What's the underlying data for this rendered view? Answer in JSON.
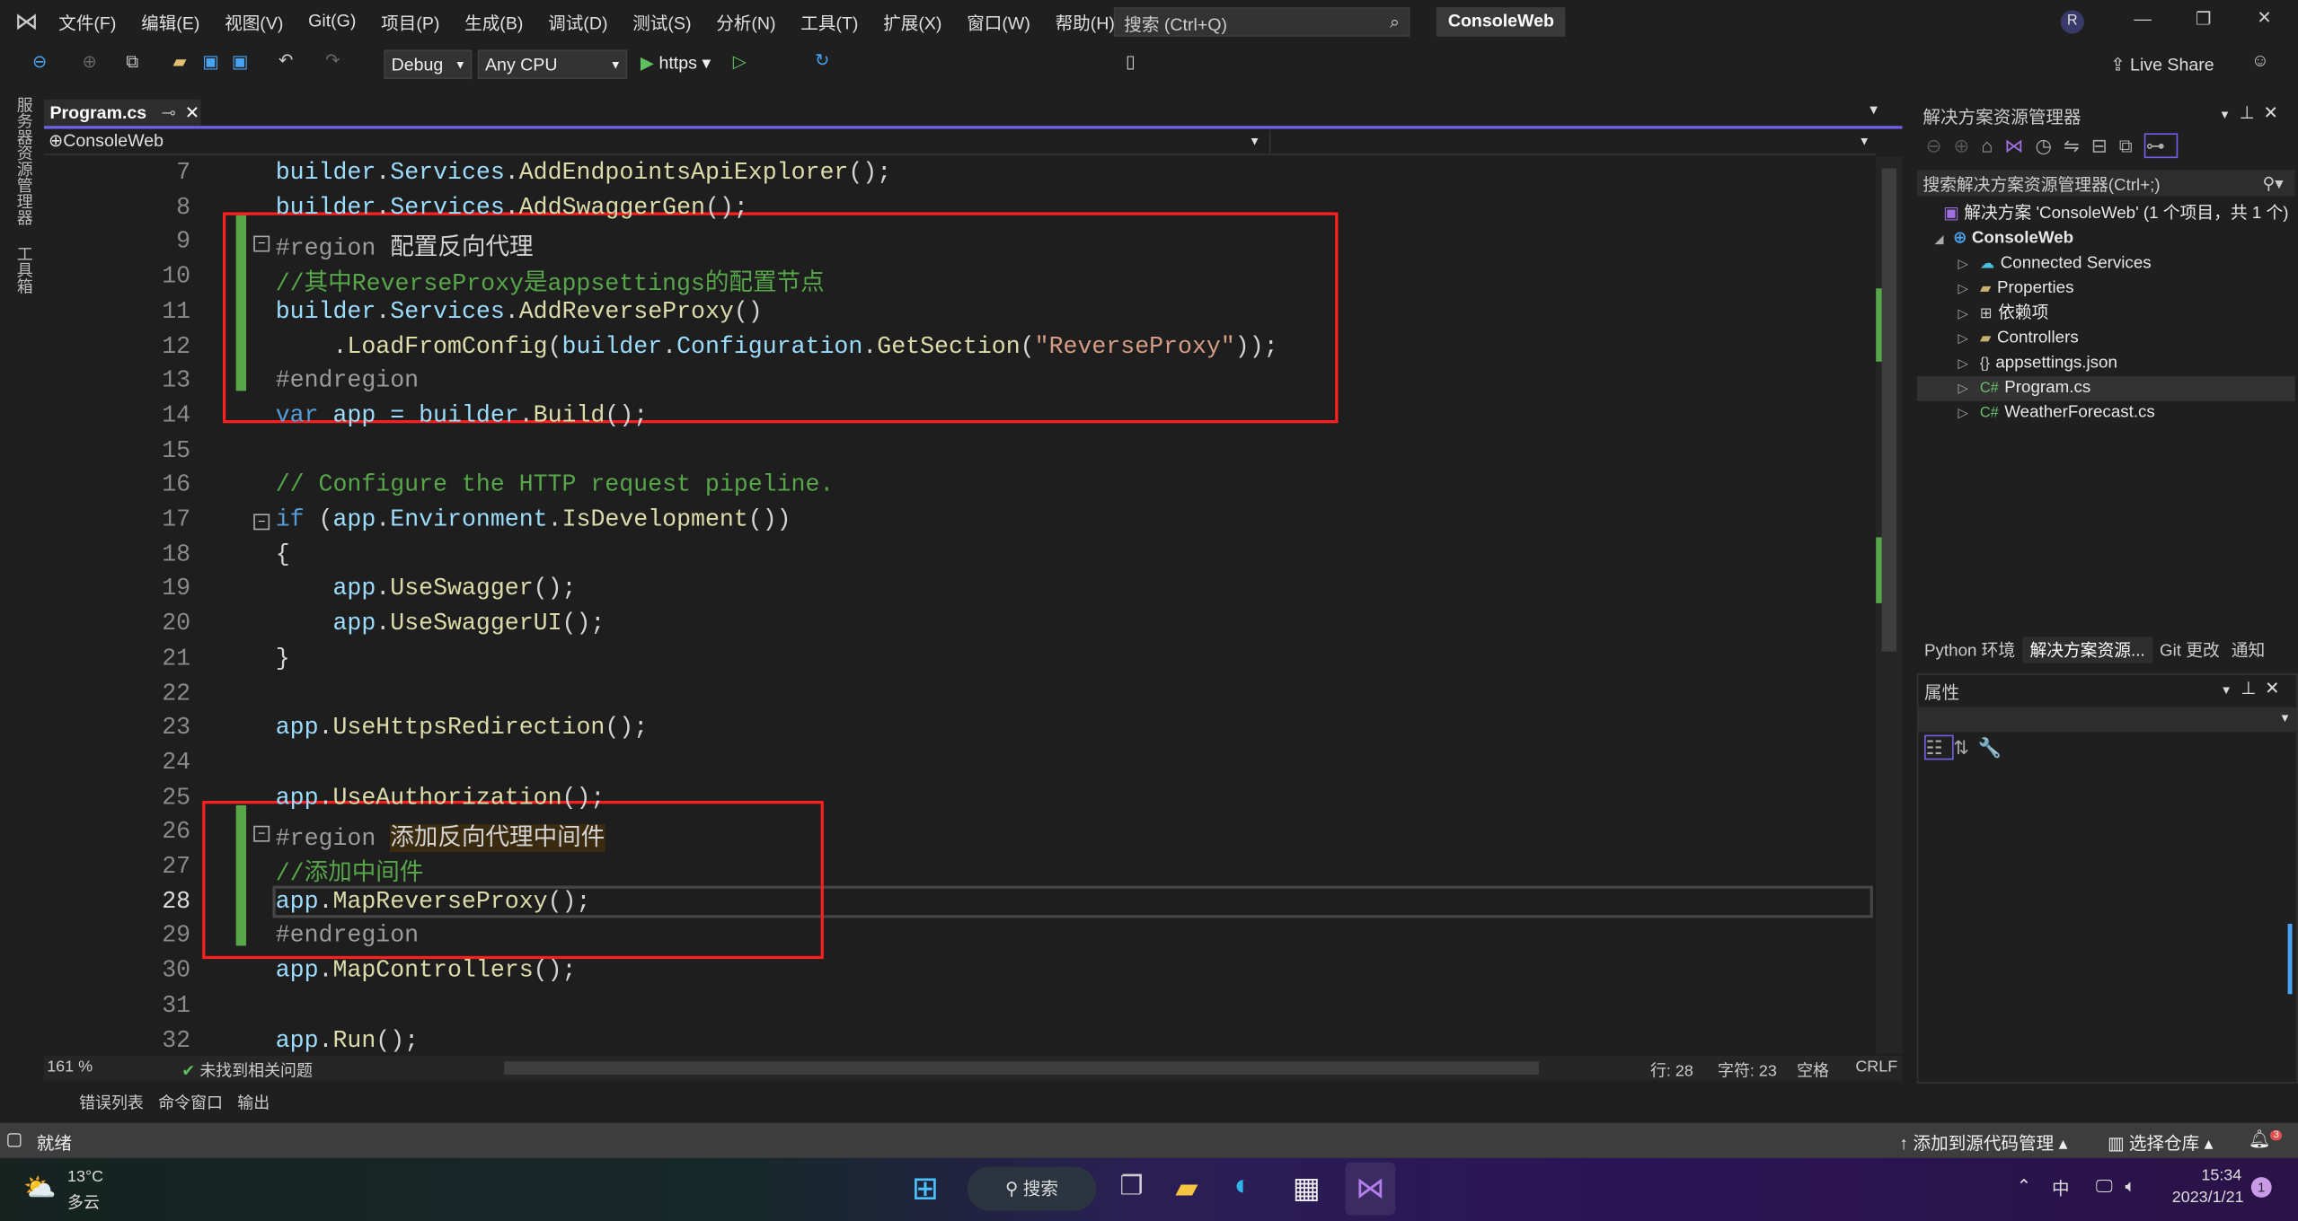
{
  "menu": {
    "items": [
      "文件(F)",
      "编辑(E)",
      "视图(V)",
      "Git(G)",
      "项目(P)",
      "生成(B)",
      "调试(D)",
      "测试(S)",
      "分析(N)",
      "工具(T)",
      "扩展(X)",
      "窗口(W)",
      "帮助(H)"
    ],
    "search_placeholder": "搜索 (Ctrl+Q)",
    "solution_title": "ConsoleWeb",
    "avatar": "R"
  },
  "toolbar": {
    "config": "Debug",
    "platform": "Any CPU",
    "run_target": "https",
    "live_share": "Live Share"
  },
  "left_strip": [
    "服务器资源管理器",
    "工具箱"
  ],
  "editor": {
    "tab": "Program.cs",
    "nav_project": "ConsoleWeb",
    "lines": [
      {
        "n": "7",
        "tokens": [
          [
            "builder",
            "id"
          ],
          [
            ".",
            "p"
          ],
          [
            "Services",
            "id"
          ],
          [
            ".",
            "p"
          ],
          [
            "AddEndpointsApiExplorer",
            "m"
          ],
          [
            "();",
            "p"
          ]
        ]
      },
      {
        "n": "8",
        "tokens": [
          [
            "builder",
            "id"
          ],
          [
            ".",
            "p"
          ],
          [
            "Services",
            "id"
          ],
          [
            ".",
            "p"
          ],
          [
            "AddSwaggerGen",
            "m"
          ],
          [
            "();",
            "p"
          ]
        ]
      },
      {
        "n": "9",
        "tokens": [
          [
            "#region ",
            "r"
          ],
          [
            "配置反向代理",
            "cn"
          ]
        ]
      },
      {
        "n": "10",
        "tokens": [
          [
            "//其中ReverseProxy是appsettings的配置节点",
            "c"
          ]
        ]
      },
      {
        "n": "11",
        "tokens": [
          [
            "builder",
            "id"
          ],
          [
            ".",
            "p"
          ],
          [
            "Services",
            "id"
          ],
          [
            ".",
            "p"
          ],
          [
            "AddReverseProxy",
            "m"
          ],
          [
            "()",
            "p"
          ]
        ]
      },
      {
        "n": "12",
        "tokens": [
          [
            "    .",
            "p"
          ],
          [
            "LoadFromConfig",
            "m"
          ],
          [
            "(",
            "p"
          ],
          [
            "builder",
            "id"
          ],
          [
            ".",
            "p"
          ],
          [
            "Configuration",
            "id"
          ],
          [
            ".",
            "p"
          ],
          [
            "GetSection",
            "m"
          ],
          [
            "(",
            "p"
          ],
          [
            "\"ReverseProxy\"",
            "s"
          ],
          [
            "));",
            "p"
          ]
        ]
      },
      {
        "n": "13",
        "tokens": [
          [
            "#endregion",
            "r"
          ]
        ]
      },
      {
        "n": "14",
        "tokens": [
          [
            "var",
            "k"
          ],
          [
            " app = ",
            "id"
          ],
          [
            "builder",
            "id"
          ],
          [
            ".",
            "p"
          ],
          [
            "Build",
            "m"
          ],
          [
            "();",
            "p"
          ]
        ]
      },
      {
        "n": "15",
        "tokens": []
      },
      {
        "n": "16",
        "tokens": [
          [
            "// Configure the HTTP request pipeline.",
            "c"
          ]
        ]
      },
      {
        "n": "17",
        "tokens": [
          [
            "if",
            "k"
          ],
          [
            " (",
            "p"
          ],
          [
            "app",
            "id"
          ],
          [
            ".",
            "p"
          ],
          [
            "Environment",
            "id"
          ],
          [
            ".",
            "p"
          ],
          [
            "IsDevelopment",
            "m"
          ],
          [
            "())",
            "p"
          ]
        ]
      },
      {
        "n": "18",
        "tokens": [
          [
            "{",
            "p"
          ]
        ]
      },
      {
        "n": "19",
        "tokens": [
          [
            "    app",
            "id"
          ],
          [
            ".",
            "p"
          ],
          [
            "UseSwagger",
            "m"
          ],
          [
            "();",
            "p"
          ]
        ]
      },
      {
        "n": "20",
        "tokens": [
          [
            "    app",
            "id"
          ],
          [
            ".",
            "p"
          ],
          [
            "UseSwaggerUI",
            "m"
          ],
          [
            "();",
            "p"
          ]
        ]
      },
      {
        "n": "21",
        "tokens": [
          [
            "}",
            "p"
          ]
        ]
      },
      {
        "n": "22",
        "tokens": []
      },
      {
        "n": "23",
        "tokens": [
          [
            "app",
            "id"
          ],
          [
            ".",
            "p"
          ],
          [
            "UseHttpsRedirection",
            "m"
          ],
          [
            "();",
            "p"
          ]
        ]
      },
      {
        "n": "24",
        "tokens": []
      },
      {
        "n": "25",
        "tokens": [
          [
            "app",
            "id"
          ],
          [
            ".",
            "p"
          ],
          [
            "UseAuthorization",
            "m"
          ],
          [
            "();",
            "p"
          ]
        ]
      },
      {
        "n": "26",
        "tokens": [
          [
            "#region ",
            "r"
          ],
          [
            "添加反向代理中间件",
            "cn"
          ]
        ]
      },
      {
        "n": "27",
        "tokens": [
          [
            "//添加中间件",
            "c"
          ]
        ]
      },
      {
        "n": "28",
        "tokens": [
          [
            "app",
            "id"
          ],
          [
            ".",
            "p"
          ],
          [
            "MapReverseProxy",
            "m"
          ],
          [
            "();",
            "p"
          ]
        ]
      },
      {
        "n": "29",
        "tokens": [
          [
            "#endregion",
            "r"
          ]
        ]
      },
      {
        "n": "30",
        "tokens": [
          [
            "app",
            "id"
          ],
          [
            ".",
            "p"
          ],
          [
            "MapControllers",
            "m"
          ],
          [
            "();",
            "p"
          ]
        ]
      },
      {
        "n": "31",
        "tokens": []
      },
      {
        "n": "32",
        "tokens": [
          [
            "app",
            "id"
          ],
          [
            ".",
            "p"
          ],
          [
            "Run",
            "m"
          ],
          [
            "();",
            "p"
          ]
        ]
      }
    ],
    "zoom": "161 %",
    "issues": "未找到相关问题",
    "line": "行: 28",
    "col": "字符: 23",
    "whitespace": "空格",
    "eol": "CRLF"
  },
  "solution_explorer": {
    "title": "解决方案资源管理器",
    "search_placeholder": "搜索解决方案资源管理器(Ctrl+;)",
    "solution": "解决方案 'ConsoleWeb' (1 个项目，共 1 个)",
    "project": "ConsoleWeb",
    "items": [
      {
        "label": "Connected Services",
        "icon": "cloud-plug"
      },
      {
        "label": "Properties",
        "icon": "folder-wrench"
      },
      {
        "label": "依赖项",
        "icon": "dependencies"
      },
      {
        "label": "Controllers",
        "icon": "folder"
      },
      {
        "label": "appsettings.json",
        "icon": "json-file"
      },
      {
        "label": "Program.cs",
        "icon": "csharp",
        "selected": true
      },
      {
        "label": "WeatherForecast.cs",
        "icon": "csharp"
      }
    ],
    "tabs": [
      "Python 环境",
      "解决方案资源...",
      "Git 更改",
      "通知"
    ]
  },
  "properties": {
    "title": "属性"
  },
  "bottom_tabs": [
    "错误列表",
    "命令窗口",
    "输出"
  ],
  "status": {
    "ready": "就绪",
    "add_source": "添加到源代码管理",
    "select_repo": "选择仓库",
    "notif_count": "3"
  },
  "taskbar": {
    "temp": "13°C",
    "weather": "多云",
    "search": "搜索",
    "time": "15:34",
    "date": "2023/1/21",
    "ime": "中",
    "badge": "1"
  },
  "colors": {
    "accent": "#7160e8",
    "highlight_box": "#ff2020",
    "change_bar": "#57a64a"
  }
}
